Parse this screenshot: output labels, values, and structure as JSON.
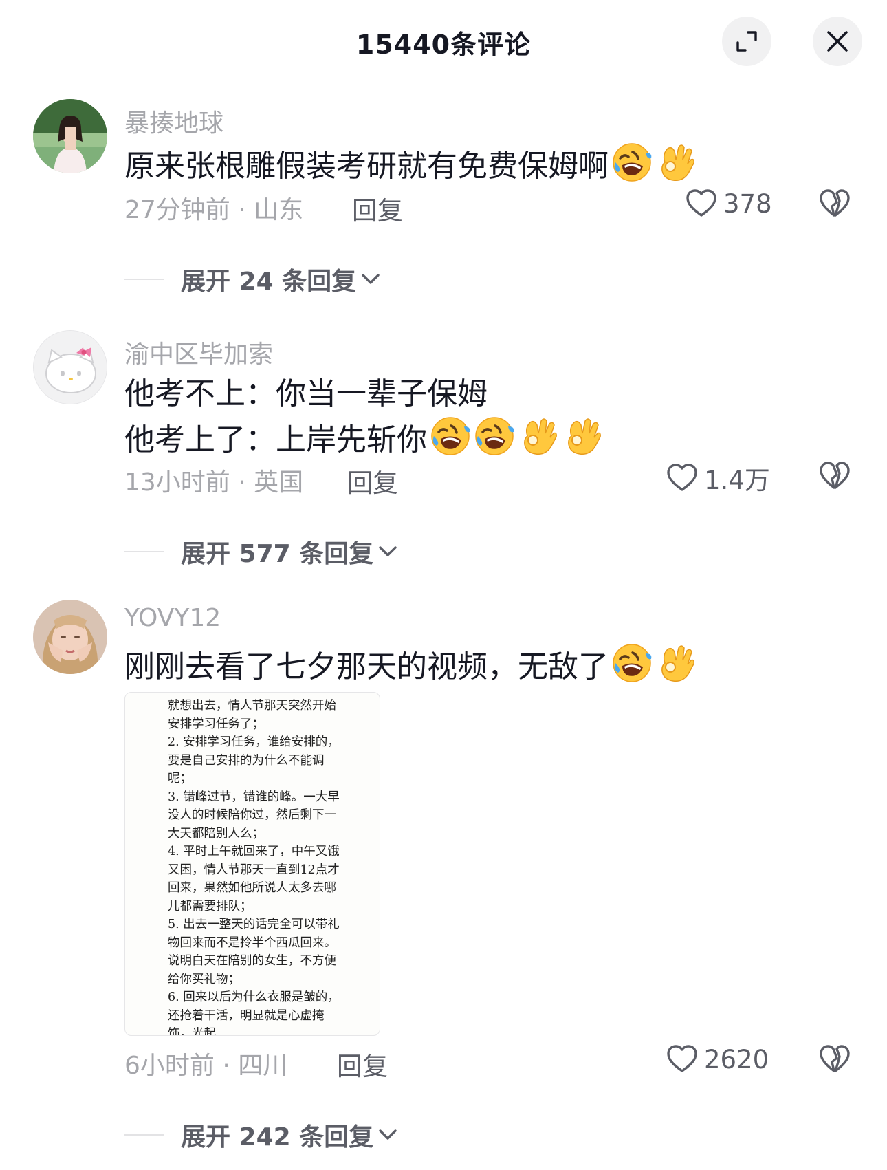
{
  "header": {
    "title": "15440条评论",
    "expand_icon": "fullscreen-icon",
    "close_icon": "close-icon"
  },
  "comments": [
    {
      "username": "暴揍地球",
      "text_lines": [
        "原来张根雕假装考研就有免费保姆啊"
      ],
      "emojis": [
        "rofl",
        "ok-hand"
      ],
      "time": "27分钟前",
      "location": "山东",
      "meta": "27分钟前 · 山东",
      "reply_label": "回复",
      "likes": "378",
      "expand_label": "展开 24 条回复"
    },
    {
      "username": "渝中区毕加索",
      "text_lines": [
        "他考不上：你当一辈子保姆",
        "他考上了：上岸先斩你"
      ],
      "emojis": [
        "rofl",
        "rofl",
        "ok-hand",
        "ok-hand"
      ],
      "time": "13小时前",
      "location": "英国",
      "meta": "13小时前 · 英国",
      "reply_label": "回复",
      "likes": "1.4万",
      "expand_label": "展开 577 条回复"
    },
    {
      "username": "YOVY12",
      "text_lines": [
        "刚刚去看了七夕那天的视频，无敌了"
      ],
      "emojis": [
        "rofl",
        "ok-hand"
      ],
      "attachment_lines": [
        "就想出去，情人节那天突然开始",
        "安排学习任务了；",
        "2. 安排学习任务，谁给安排的，",
        "要是自己安排的为什么不能调",
        "呢；",
        "3. 错峰过节，错谁的峰。一大早",
        "没人的时候陪你过，然后剩下一",
        "大天都陪别人么；",
        "4. 平时上午就回来了，中午又饿",
        "又困，情人节那天一直到12点才",
        "回来，果然如他所说人太多去哪",
        "儿都需要排队；",
        "5. 出去一整天的话完全可以带礼",
        "物回来而不是拎半个西瓜回来。",
        "说明白天在陪别的女生，不方便",
        "给你买礼物；",
        "6. 回来以后为什么衣服是皱的，",
        "还抢着干活，明显就是心虚掩",
        "饰，光起"
      ],
      "time": "6小时前",
      "location": "四川",
      "meta": "6小时前 · 四川",
      "reply_label": "回复",
      "likes": "2620",
      "expand_label": "展开 242 条回复"
    }
  ],
  "colors": {
    "text_primary": "#161823",
    "text_secondary": "#a5a6ab",
    "text_action": "#5b5d66",
    "button_bg": "#f1f1f2"
  }
}
